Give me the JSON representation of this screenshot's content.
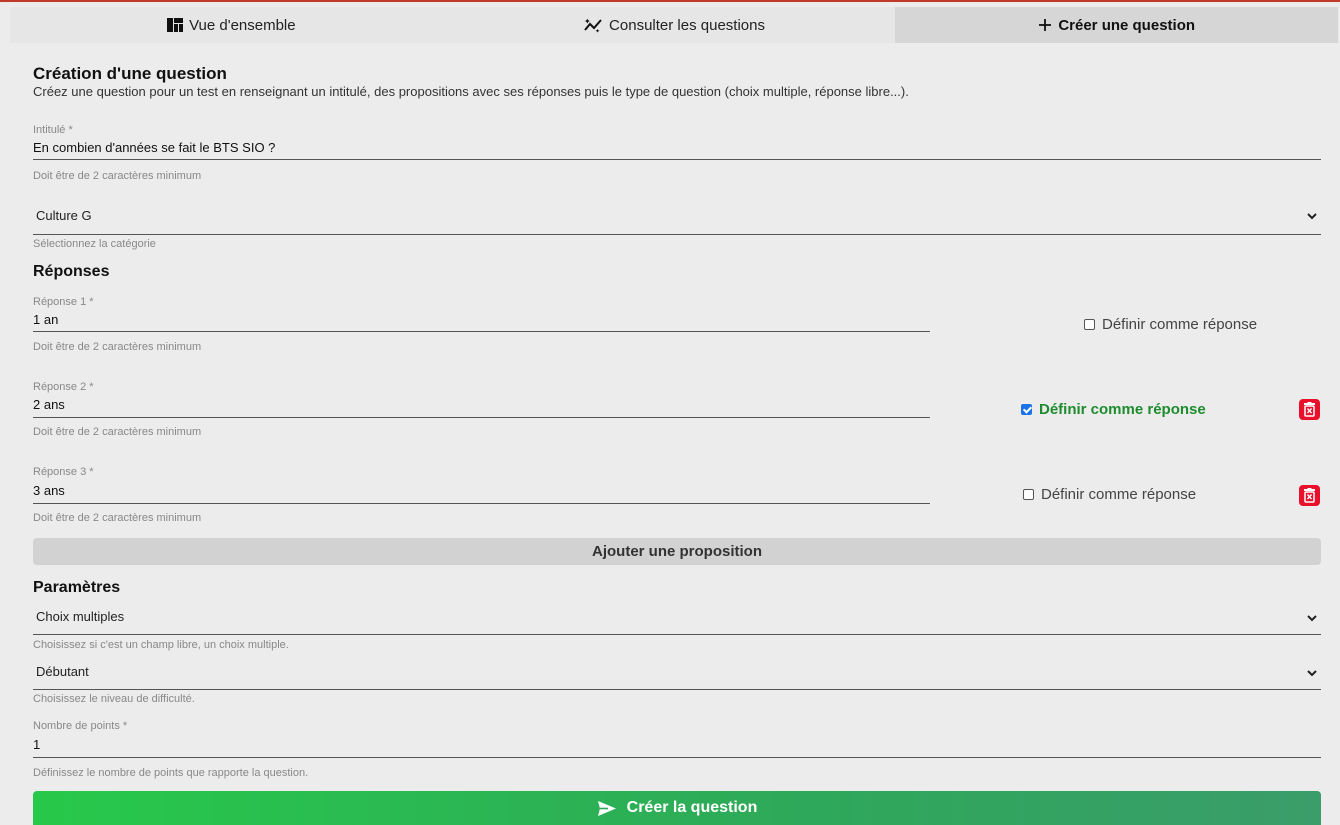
{
  "tabs": [
    {
      "label": "Vue d'ensemble",
      "icon": "dashboard-icon"
    },
    {
      "label": "Consulter les questions",
      "icon": "sparkle-chart-icon"
    },
    {
      "label": "Créer une question",
      "icon": "plus-icon",
      "active": true
    }
  ],
  "header": {
    "title": "Création d'une question",
    "description": "Créez une question pour un test en renseignant un intitulé, des propositions avec ses réponses puis le type de question (choix multiple, réponse libre...)."
  },
  "intitule": {
    "label": "Intitulé *",
    "value": "En combien d'années se fait le BTS SIO ?",
    "helper": "Doit être de 2 caractères minimum"
  },
  "categorie": {
    "value": "Culture G",
    "helper": "Sélectionnez la catégorie"
  },
  "reponses": {
    "section_title": "Réponses",
    "items": [
      {
        "label": "Réponse 1 *",
        "value": "1 an",
        "helper": "Doit être de 2 caractères minimum",
        "check_label": "Définir comme réponse",
        "checked": false
      },
      {
        "label": "Réponse 2 *",
        "value": "2 ans",
        "helper": "Doit être de 2 caractères minimum",
        "check_label": "Définir comme réponse",
        "checked": true
      },
      {
        "label": "Réponse 3 *",
        "value": "3 ans",
        "helper": "Doit être de 2 caractères minimum",
        "check_label": "Définir comme réponse",
        "checked": false
      }
    ],
    "add_label": "Ajouter une proposition"
  },
  "parametres": {
    "section_title": "Paramètres",
    "type": {
      "value": "Choix multiples",
      "helper": "Choisissez si c'est un champ libre, un choix multiple."
    },
    "niveau": {
      "value": "Débutant",
      "helper": "Choisissez le niveau de difficulté."
    },
    "points": {
      "label": "Nombre de points *",
      "value": "1",
      "helper": "Définissez le nombre de points que rapporte la question."
    }
  },
  "submit_label": "Créer la question",
  "colors": {
    "accent_green": "#1e8c2e",
    "delete_red": "#e8102a",
    "checkbox_blue": "#1a73e8"
  }
}
